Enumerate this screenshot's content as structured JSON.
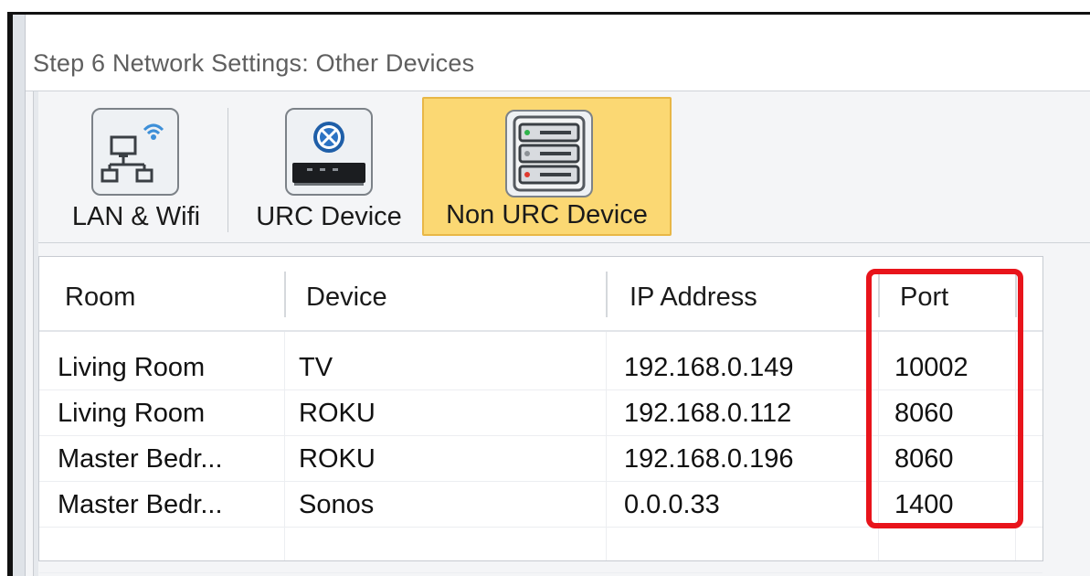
{
  "window": {
    "title": "Step 6 Network Settings: Other Devices"
  },
  "ribbon": {
    "buttons": [
      {
        "label": "LAN & Wifi",
        "icon": "network-wifi-icon",
        "selected": false
      },
      {
        "label": "URC Device",
        "icon": "urc-controller-icon",
        "selected": false
      },
      {
        "label": "Non URC Device",
        "icon": "server-rack-icon",
        "selected": true
      }
    ]
  },
  "table": {
    "columns": [
      "Room",
      "Device",
      "IP Address",
      "Port"
    ],
    "rows": [
      {
        "room": "Living Room",
        "device": "TV",
        "ip": "192.168.0.149",
        "port": "10002"
      },
      {
        "room": "Living Room",
        "device": "ROKU",
        "ip": "192.168.0.112",
        "port": "8060"
      },
      {
        "room": "Master Bedr...",
        "device": "ROKU",
        "ip": "192.168.0.196",
        "port": "8060"
      },
      {
        "room": "Master Bedr...",
        "device": "Sonos",
        "ip": "0.0.0.33",
        "port": "1400"
      }
    ]
  },
  "colors": {
    "selected_bg": "#fbd873",
    "highlight": "#e8141b"
  }
}
